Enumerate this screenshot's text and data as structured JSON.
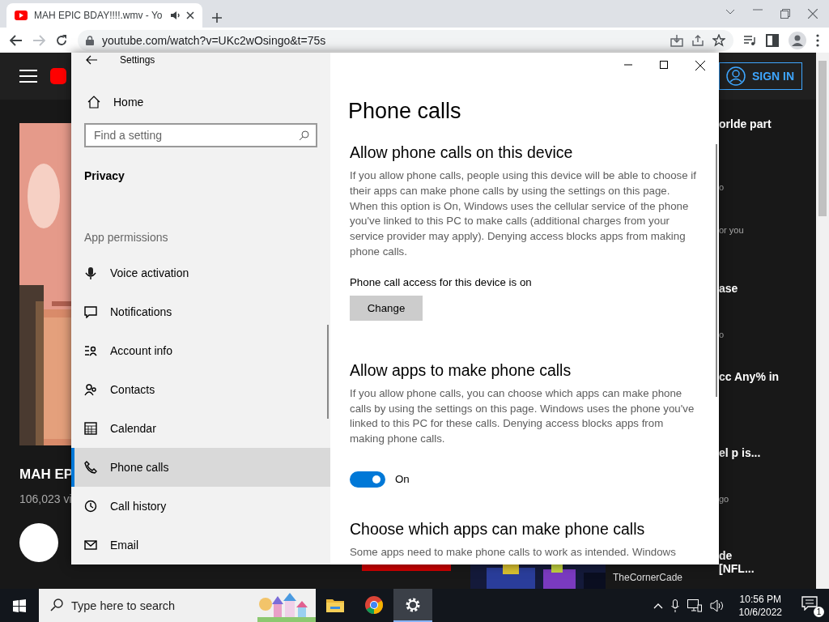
{
  "browser": {
    "tab_title": "MAH EPIC BDAY!!!!.wmv - Yo",
    "url": "youtube.com/watch?v=UKc2wOsingo&t=75s"
  },
  "youtube": {
    "sign_in": "SIGN IN",
    "video_title": "MAH EP",
    "views": "106,023 vi",
    "channel_name": "TheCornerCade",
    "sidebar": [
      {
        "kind": "title",
        "text": "orlde part"
      },
      {
        "kind": "meta",
        "text": "o"
      },
      {
        "kind": "meta",
        "text": "or you"
      },
      {
        "kind": "title",
        "text": "ase"
      },
      {
        "kind": "meta",
        "text": "o"
      },
      {
        "kind": "title",
        "text": "cc Any% in"
      },
      {
        "kind": "title",
        "text": "el p is..."
      },
      {
        "kind": "meta",
        "text": "go"
      },
      {
        "kind": "title",
        "text": "de"
      },
      {
        "kind": "title",
        "text": "[NFL..."
      }
    ]
  },
  "settings": {
    "title": "Settings",
    "home": "Home",
    "search": {
      "placeholder": "Find a setting"
    },
    "section": "Privacy",
    "group": "App permissions",
    "nav_items": [
      {
        "label": "Voice activation",
        "kind": "mic",
        "selected": false
      },
      {
        "label": "Notifications",
        "kind": "bubble",
        "selected": false
      },
      {
        "label": "Account info",
        "kind": "account",
        "selected": false
      },
      {
        "label": "Contacts",
        "kind": "contacts",
        "selected": false
      },
      {
        "label": "Calendar",
        "kind": "calendar",
        "selected": false
      },
      {
        "label": "Phone calls",
        "kind": "phone",
        "selected": true
      },
      {
        "label": "Call history",
        "kind": "history",
        "selected": false
      },
      {
        "label": "Email",
        "kind": "mail",
        "selected": false
      }
    ],
    "page_title": "Phone calls",
    "content": [
      {
        "kind": "heading",
        "text": "Allow phone calls on this device"
      },
      {
        "kind": "paragraph",
        "text": "If you allow phone calls, people using this device will be able to choose if their apps can make phone calls by using the settings on this page. When this option is On, Windows uses the cellular service of the phone you've linked to this PC to make calls (additional charges from your service provider may apply). Denying access blocks apps from making phone calls."
      },
      {
        "kind": "label",
        "text": "Phone call access for this device is on"
      },
      {
        "kind": "button",
        "text": "Change"
      },
      {
        "kind": "heading",
        "text": "Allow apps to make phone calls"
      },
      {
        "kind": "paragraph",
        "text": "If you allow phone calls, you can choose which apps can make phone calls by using the settings on this page. Windows uses the phone you've linked to this PC for these calls. Denying access blocks apps from making phone calls."
      },
      {
        "kind": "toggle",
        "on": true,
        "text": "On"
      },
      {
        "kind": "heading",
        "text": "Choose which apps can make phone calls"
      },
      {
        "kind": "paragraph",
        "text": "Some apps need to make phone calls to work as intended. Windows"
      }
    ]
  },
  "taskbar": {
    "search": {
      "placeholder": "Type here to search"
    },
    "apps": [
      {
        "kind": "folder",
        "selected": false
      },
      {
        "kind": "chrome",
        "selected": false
      },
      {
        "kind": "gear",
        "selected": true
      }
    ],
    "time": "10:56 PM",
    "date": "10/6/2022",
    "notification_count": "1"
  }
}
